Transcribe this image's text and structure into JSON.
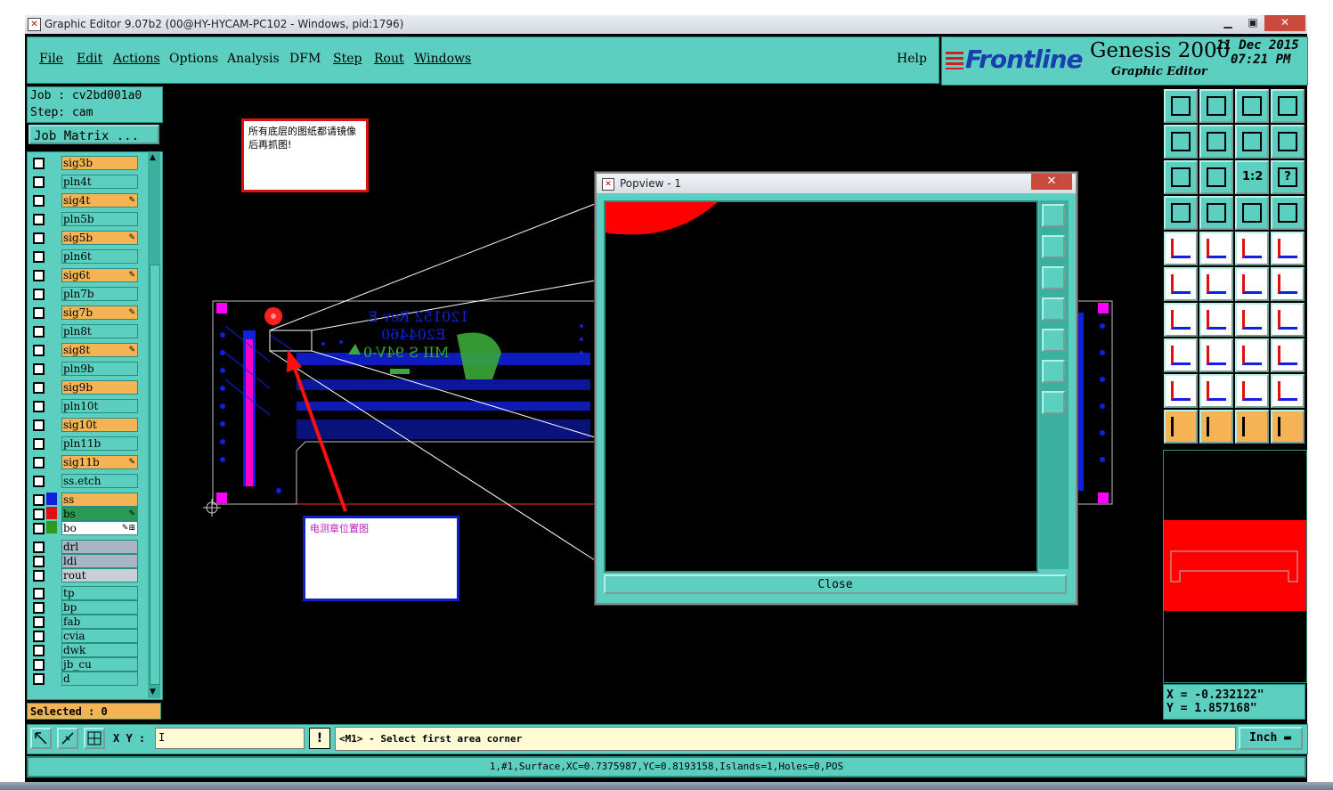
{
  "window": {
    "title": "Graphic Editor 9.07b2 (00@HY-HYCAM-PC102 - Windows, pid:1796)",
    "buttons": [
      "minimize-icon",
      "maximize-icon",
      "close-icon"
    ]
  },
  "menu": {
    "items": [
      "File",
      "Edit",
      "Actions",
      "Options",
      "Analysis",
      "DFM",
      "Step",
      "Rout",
      "Windows"
    ],
    "help": "Help"
  },
  "brand": {
    "logo": "Frontline",
    "product": "Genesis 2000",
    "subtitle": "Graphic Editor",
    "date": "11 Dec 2015",
    "time": "07:21 PM"
  },
  "job": {
    "job_line": "Job : cv2bd001a0",
    "step_line": "Step: cam",
    "matrix_button": "Job Matrix ..."
  },
  "layers": [
    {
      "name": "sig3b",
      "color": "#f4b454",
      "mark": ""
    },
    {
      "name": "pln4t",
      "color": "#5ccfc0",
      "mark": ""
    },
    {
      "name": "sig4t",
      "color": "#f4b454",
      "mark": "✎"
    },
    {
      "name": "pln5b",
      "color": "#5ccfc0",
      "mark": ""
    },
    {
      "name": "sig5b",
      "color": "#f4b454",
      "mark": "✎"
    },
    {
      "name": "pln6t",
      "color": "#5ccfc0",
      "mark": ""
    },
    {
      "name": "sig6t",
      "color": "#f4b454",
      "mark": "✎"
    },
    {
      "name": "pln7b",
      "color": "#5ccfc0",
      "mark": ""
    },
    {
      "name": "sig7b",
      "color": "#f4b454",
      "mark": "✎"
    },
    {
      "name": "pln8t",
      "color": "#5ccfc0",
      "mark": ""
    },
    {
      "name": "sig8t",
      "color": "#f4b454",
      "mark": "✎"
    },
    {
      "name": "pln9b",
      "color": "#5ccfc0",
      "mark": ""
    },
    {
      "name": "sig9b",
      "color": "#f4b454",
      "mark": ""
    },
    {
      "name": "pln10t",
      "color": "#5ccfc0",
      "mark": ""
    },
    {
      "name": "sig10t",
      "color": "#f4b454",
      "mark": ""
    },
    {
      "name": "pln11b",
      "color": "#5ccfc0",
      "mark": ""
    },
    {
      "name": "sig11b",
      "color": "#f4b454",
      "mark": "✎"
    },
    {
      "name": "ss.etch",
      "color": "#5ccfc0",
      "mark": ""
    }
  ],
  "active_layers": [
    {
      "name": "ss",
      "swatch": "#1020e0",
      "bg": "#f4b454",
      "mark": ""
    },
    {
      "name": "bs",
      "swatch": "#e01010",
      "bg": "#2a9a55",
      "mark": "✎"
    },
    {
      "name": "bo",
      "swatch": "#2a9a20",
      "bg": "#ffffff",
      "mark": "✎⊞"
    }
  ],
  "other_layers_a": [
    {
      "name": "drl",
      "color": "#a9b4c4"
    },
    {
      "name": "ldi",
      "color": "#a9b4c4"
    },
    {
      "name": "rout",
      "color": "#c9cfd6"
    }
  ],
  "other_layers_b": [
    {
      "name": "tp",
      "color": "#5ccfc0"
    },
    {
      "name": "bp",
      "color": "#5ccfc0"
    },
    {
      "name": "fab",
      "color": "#5ccfc0"
    },
    {
      "name": "cvia",
      "color": "#5ccfc0"
    },
    {
      "name": "dwk",
      "color": "#5ccfc0"
    },
    {
      "name": "jb_cu",
      "color": "#5ccfc0"
    },
    {
      "name": "d",
      "color": "#5ccfc0"
    }
  ],
  "selected": "Selected : 0",
  "notes": {
    "top": "所有底层的图纸都请镜像后再抓图!",
    "bottom": "电测章位置图"
  },
  "board_text": {
    "line1": "120152 Rev E",
    "line2": "E204460",
    "line3": "MII S 94V-0"
  },
  "popview": {
    "title": "Popview - 1",
    "close": "Close"
  },
  "tool_buttons": {
    "labels": [
      "1:2",
      "?"
    ]
  },
  "coords": {
    "x": "X = -0.232122\"",
    "y": "Y = 1.857168\""
  },
  "bottom": {
    "xy_label": "X Y :",
    "xy_value": "I",
    "bang": "!",
    "prompt": "<M1> - Select first area corner",
    "unit": "Inch"
  },
  "status": "1,#1,Surface,XC=0.7375987,YC=0.8193158,Islands=1,Holes=0,POS",
  "colors": {
    "panel": "#5ccfc0",
    "signal_layer": "#f4b454",
    "canvas": "#000000",
    "board_copper": "#1020e0",
    "highlight": "#ff0000"
  }
}
